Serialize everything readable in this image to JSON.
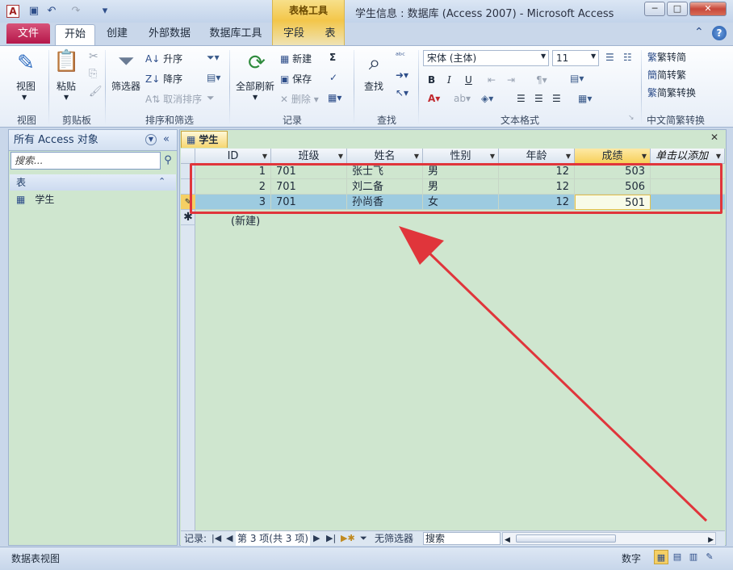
{
  "window": {
    "title": "学生信息 : 数据库 (Access 2007)  -  Microsoft Access",
    "contextual_tools_label": "表格工具",
    "app_icon": "A",
    "qat_icons": [
      "save-icon",
      "undo-icon",
      "redo-icon",
      "customize-icon"
    ],
    "controls": [
      "minimize",
      "maximize",
      "close"
    ]
  },
  "tabs": {
    "file": "文件",
    "home": "开始",
    "create": "创建",
    "external": "外部数据",
    "dbtools": "数据库工具",
    "fields": "字段",
    "table": "表"
  },
  "ribbon": {
    "view": {
      "label": "视图",
      "group": "视图"
    },
    "clipboard": {
      "paste": "粘贴",
      "group": "剪贴板"
    },
    "sort": {
      "filter": "筛选器",
      "asc": "升序",
      "desc": "降序",
      "clear": "取消排序",
      "group": "排序和筛选"
    },
    "records": {
      "refresh": "全部刷新",
      "new": "新建",
      "save": "保存",
      "delete": "删除",
      "group": "记录"
    },
    "find": {
      "label": "查找",
      "group": "查找"
    },
    "text": {
      "font": "宋体 (主体)",
      "size": "11",
      "bold": "B",
      "italic": "I",
      "underline": "U",
      "group": "文本格式"
    },
    "chinese": {
      "to_simp": "繁转简",
      "to_trad": "简转繁",
      "convert": "简繁转换",
      "group": "中文简繁转换"
    }
  },
  "nav": {
    "title": "所有 Access 对象",
    "search_placeholder": "搜索...",
    "section": "表",
    "item": "学生"
  },
  "doc": {
    "tab": "学生"
  },
  "columns": [
    {
      "label": "ID"
    },
    {
      "label": "班级"
    },
    {
      "label": "姓名"
    },
    {
      "label": "性别"
    },
    {
      "label": "年龄"
    },
    {
      "label": "成绩"
    },
    {
      "label": "单击以添加"
    }
  ],
  "rows": [
    {
      "id": "1",
      "cls": "701",
      "name": "张士飞",
      "sex": "男",
      "age": "12",
      "score": "503"
    },
    {
      "id": "2",
      "cls": "701",
      "name": "刘二备",
      "sex": "男",
      "age": "12",
      "score": "506"
    },
    {
      "id": "3",
      "cls": "701",
      "name": "孙尚香",
      "sex": "女",
      "age": "12",
      "score": "501"
    }
  ],
  "new_row": "(新建)",
  "record_nav": {
    "label": "记录:",
    "position": "第 3 项(共 3 项)",
    "filter": "无筛选器",
    "search": "搜索"
  },
  "status": {
    "left": "数据表视图",
    "num": "数字"
  },
  "annotation_color": "#e0353b"
}
